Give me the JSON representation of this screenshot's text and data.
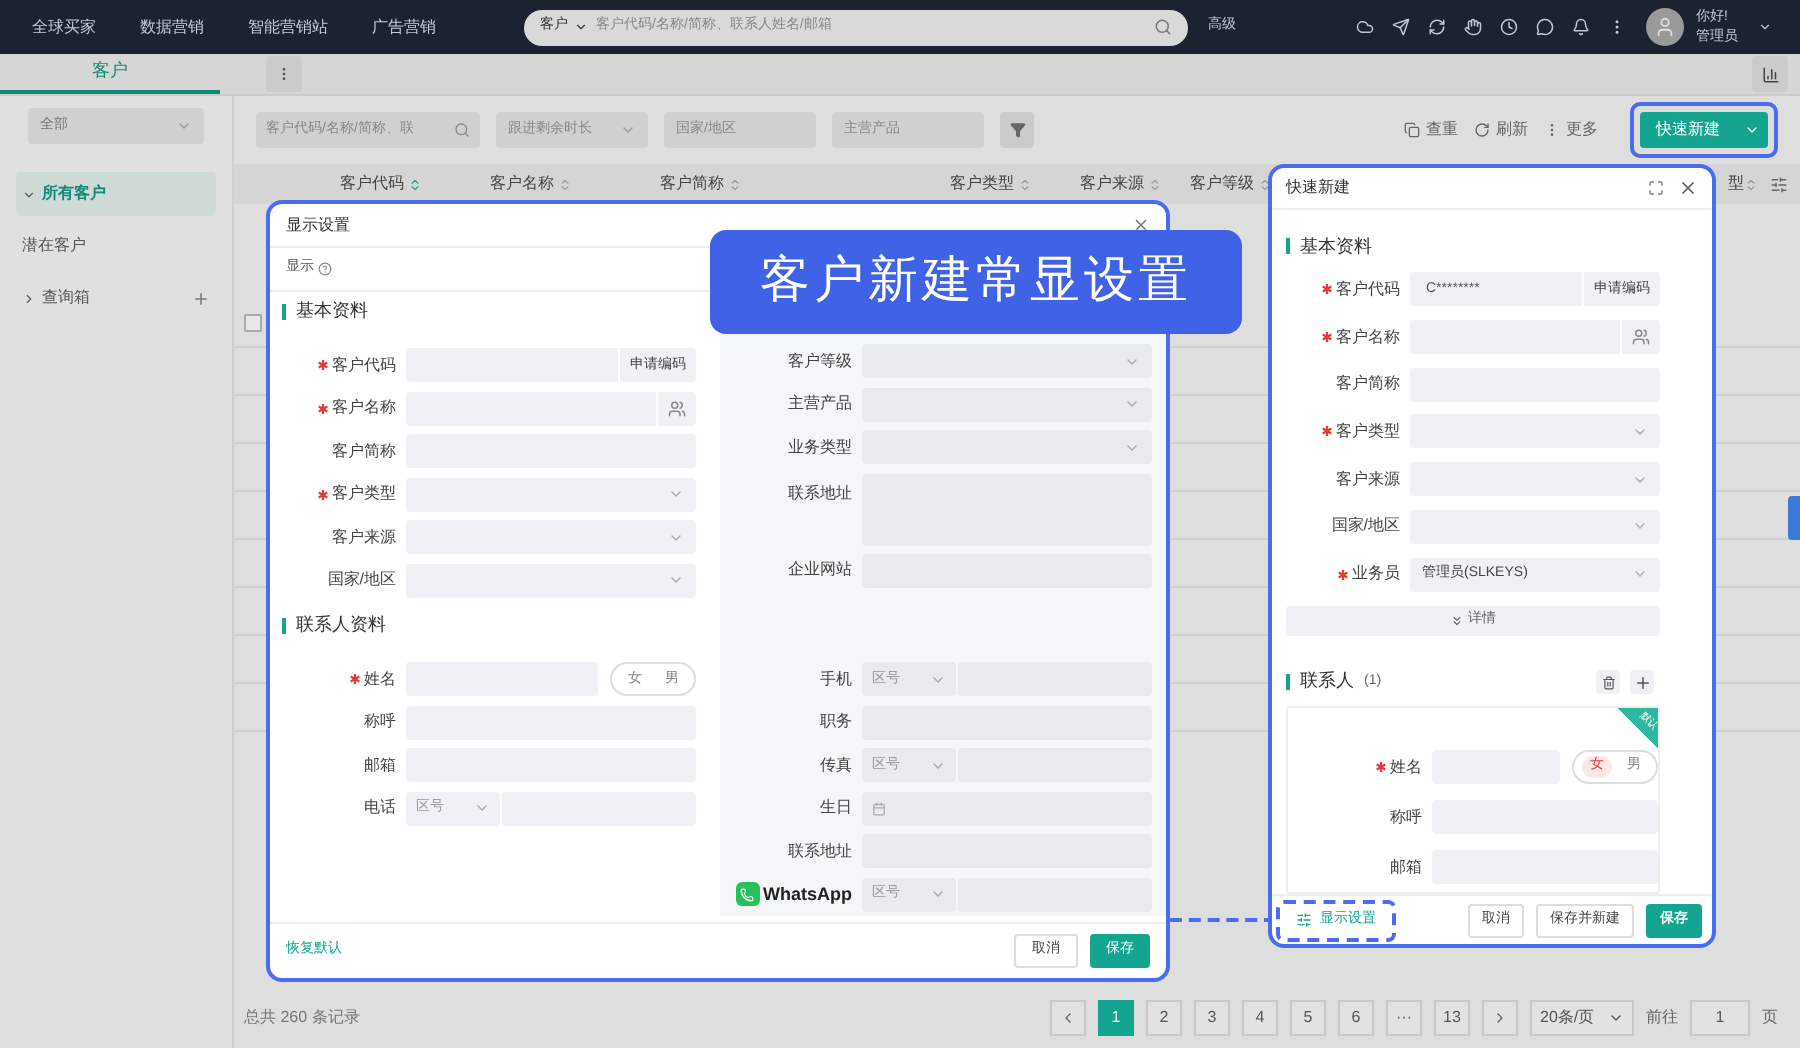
{
  "top_nav": {
    "menu": [
      "全球买家",
      "数据营销",
      "智能营销站",
      "广告营销"
    ],
    "search": {
      "scope": "客户",
      "placeholder": "客户代码/名称/简称、联系人姓名/邮箱"
    },
    "advanced": "高级",
    "greeting": "你好!",
    "user": "管理员"
  },
  "tabs": [
    {
      "label": "客户",
      "selected": true
    }
  ],
  "sidebar": {
    "filter": "全部",
    "items": [
      {
        "label": "所有客户",
        "kind": "folder",
        "expanded": true,
        "selected": true
      },
      {
        "label": "潜在客户",
        "kind": "item",
        "selected": false
      },
      {
        "label": "查询箱",
        "kind": "box",
        "expanded": false,
        "selected": false
      }
    ]
  },
  "toolbar": {
    "search_placeholder": "客户代码/名称/简称、联",
    "filters": [
      {
        "placeholder": "跟进剩余时长",
        "kind": "select"
      },
      {
        "placeholder": "国家/地区",
        "kind": "input"
      },
      {
        "placeholder": "主营产品",
        "kind": "input"
      }
    ],
    "actions": [
      {
        "label": "查重",
        "kind": "duplicate"
      },
      {
        "label": "刷新",
        "kind": "refresh"
      },
      {
        "label": "更多",
        "kind": "more"
      }
    ],
    "create_button": "快速新建"
  },
  "table": {
    "columns": [
      {
        "label": "客户代码",
        "sorted": true
      },
      {
        "label": "客户名称",
        "sorted": false
      },
      {
        "label": "客户简称",
        "sorted": false
      },
      {
        "label": "客户类型",
        "sorted": false
      },
      {
        "label": "客户来源",
        "sorted": false
      },
      {
        "label": "客户等级",
        "sorted": false
      }
    ],
    "last_column": "型",
    "rows": [
      {
        "checked": false
      }
    ]
  },
  "pagination": {
    "total": "总共 260 条记录",
    "pages": [
      {
        "label": "1",
        "selected": true
      },
      {
        "label": "2",
        "selected": false
      },
      {
        "label": "3",
        "selected": false
      },
      {
        "label": "4",
        "selected": false
      },
      {
        "label": "5",
        "selected": false
      },
      {
        "label": "6",
        "selected": false
      },
      {
        "label": "···",
        "selected": false
      },
      {
        "label": "13",
        "selected": false
      }
    ],
    "page_size": "20条/页",
    "goto_label": "前往",
    "goto_value": "1",
    "goto_unit": "页"
  },
  "settings_dialog": {
    "title": "显示设置",
    "tab": "显示",
    "sections": [
      {
        "title": "基本资料",
        "left": [
          {
            "label": "客户代码",
            "required": true,
            "kind": "code",
            "action": "申请编码"
          },
          {
            "label": "客户名称",
            "required": true,
            "kind": "name"
          },
          {
            "label": "客户简称",
            "required": false,
            "kind": "input"
          },
          {
            "label": "客户类型",
            "required": true,
            "kind": "select"
          },
          {
            "label": "客户来源",
            "required": false,
            "kind": "select"
          },
          {
            "label": "国家/地区",
            "required": false,
            "kind": "select"
          }
        ],
        "right": [
          {
            "label": "客户等级",
            "required": false,
            "kind": "select"
          },
          {
            "label": "主营产品",
            "required": false,
            "kind": "select"
          },
          {
            "label": "业务类型",
            "required": false,
            "kind": "select"
          },
          {
            "label": "联系地址",
            "required": false,
            "kind": "textarea"
          },
          {
            "label": "企业网站",
            "required": false,
            "kind": "input"
          }
        ]
      },
      {
        "title": "联系人资料",
        "left": [
          {
            "label": "姓名",
            "required": true,
            "kind": "gender",
            "options": [
              {
                "label": "女",
                "selected": false
              },
              {
                "label": "男",
                "selected": false
              }
            ]
          },
          {
            "label": "称呼",
            "required": false,
            "kind": "input"
          },
          {
            "label": "邮箱",
            "required": false,
            "kind": "input"
          },
          {
            "label": "电话",
            "required": false,
            "kind": "phone",
            "placeholder": "区号"
          }
        ],
        "right": [
          {
            "label": "手机",
            "required": false,
            "kind": "phone",
            "placeholder": "区号"
          },
          {
            "label": "职务",
            "required": false,
            "kind": "input"
          },
          {
            "label": "传真",
            "required": false,
            "kind": "phone",
            "placeholder": "区号"
          },
          {
            "label": "生日",
            "required": false,
            "kind": "date"
          },
          {
            "label": "联系地址",
            "required": false,
            "kind": "input"
          },
          {
            "label": "WhatsApp",
            "required": false,
            "kind": "phone",
            "placeholder": "区号",
            "icon": true
          }
        ]
      }
    ],
    "reset": "恢复默认",
    "cancel": "取消",
    "save": "保存"
  },
  "callout": "客户新建常显设置",
  "quick_dialog": {
    "title": "快速新建",
    "section_title": "基本资料",
    "fields": [
      {
        "label": "客户代码",
        "required": true,
        "kind": "code",
        "value": "C********",
        "action": "申请编码"
      },
      {
        "label": "客户名称",
        "required": true,
        "kind": "name"
      },
      {
        "label": "客户简称",
        "required": false,
        "kind": "input"
      },
      {
        "label": "客户类型",
        "required": true,
        "kind": "select"
      },
      {
        "label": "客户来源",
        "required": false,
        "kind": "select"
      },
      {
        "label": "国家/地区",
        "required": false,
        "kind": "select"
      },
      {
        "label": "业务员",
        "required": true,
        "kind": "select",
        "value": "管理员(SLKEYS)"
      }
    ],
    "details": "详情",
    "contacts_title": "联系人",
    "contacts_count": "(1)",
    "ribbon": "默认",
    "contact_fields": [
      {
        "label": "姓名",
        "required": true,
        "kind": "gender",
        "options": [
          {
            "label": "女",
            "selected": true
          },
          {
            "label": "男",
            "selected": false
          }
        ]
      },
      {
        "label": "称呼",
        "required": false,
        "kind": "input"
      },
      {
        "label": "邮箱",
        "required": false,
        "kind": "input"
      }
    ],
    "settings": "显示设置",
    "cancel": "取消",
    "save_new": "保存并新建",
    "save": "保存"
  }
}
